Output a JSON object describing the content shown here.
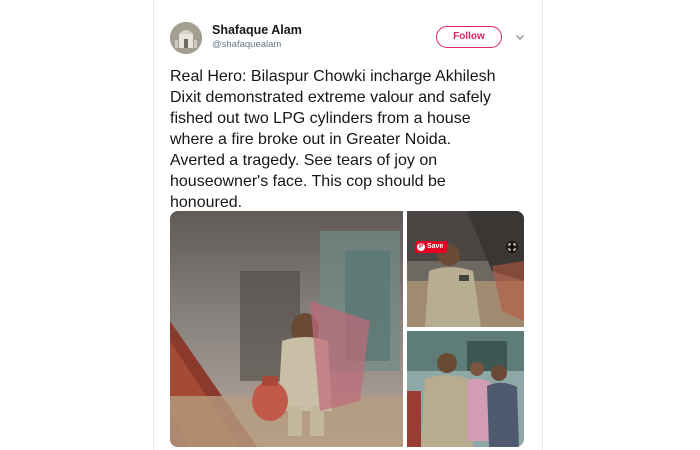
{
  "user": {
    "display_name": "Shafaque Alam",
    "handle": "@shafaquealam"
  },
  "actions": {
    "follow_label": "Follow"
  },
  "tweet": {
    "text": "Real Hero: Bilaspur Chowki incharge Akhilesh\nDixit demonstrated extreme valour and safely\nfished out two LPG cylinders from a house\nwhere a fire broke out in Greater Noida.\nAverted a tragedy. See tears of joy on\nhouseowner's face. This cop should be\nhonoured."
  },
  "media": {
    "save_label": "Save",
    "photos": [
      {
        "position": "main",
        "description_icon": "photo"
      },
      {
        "position": "top-right",
        "description_icon": "photo"
      },
      {
        "position": "bottom-right",
        "description_icon": "photo"
      }
    ]
  },
  "colors": {
    "follow_accent": "#e0245e",
    "pinterest_red": "#e60023",
    "text": "#14171a",
    "muted": "#657786"
  },
  "icons": [
    "chevron-down-icon",
    "pin-icon",
    "expand-icon"
  ]
}
